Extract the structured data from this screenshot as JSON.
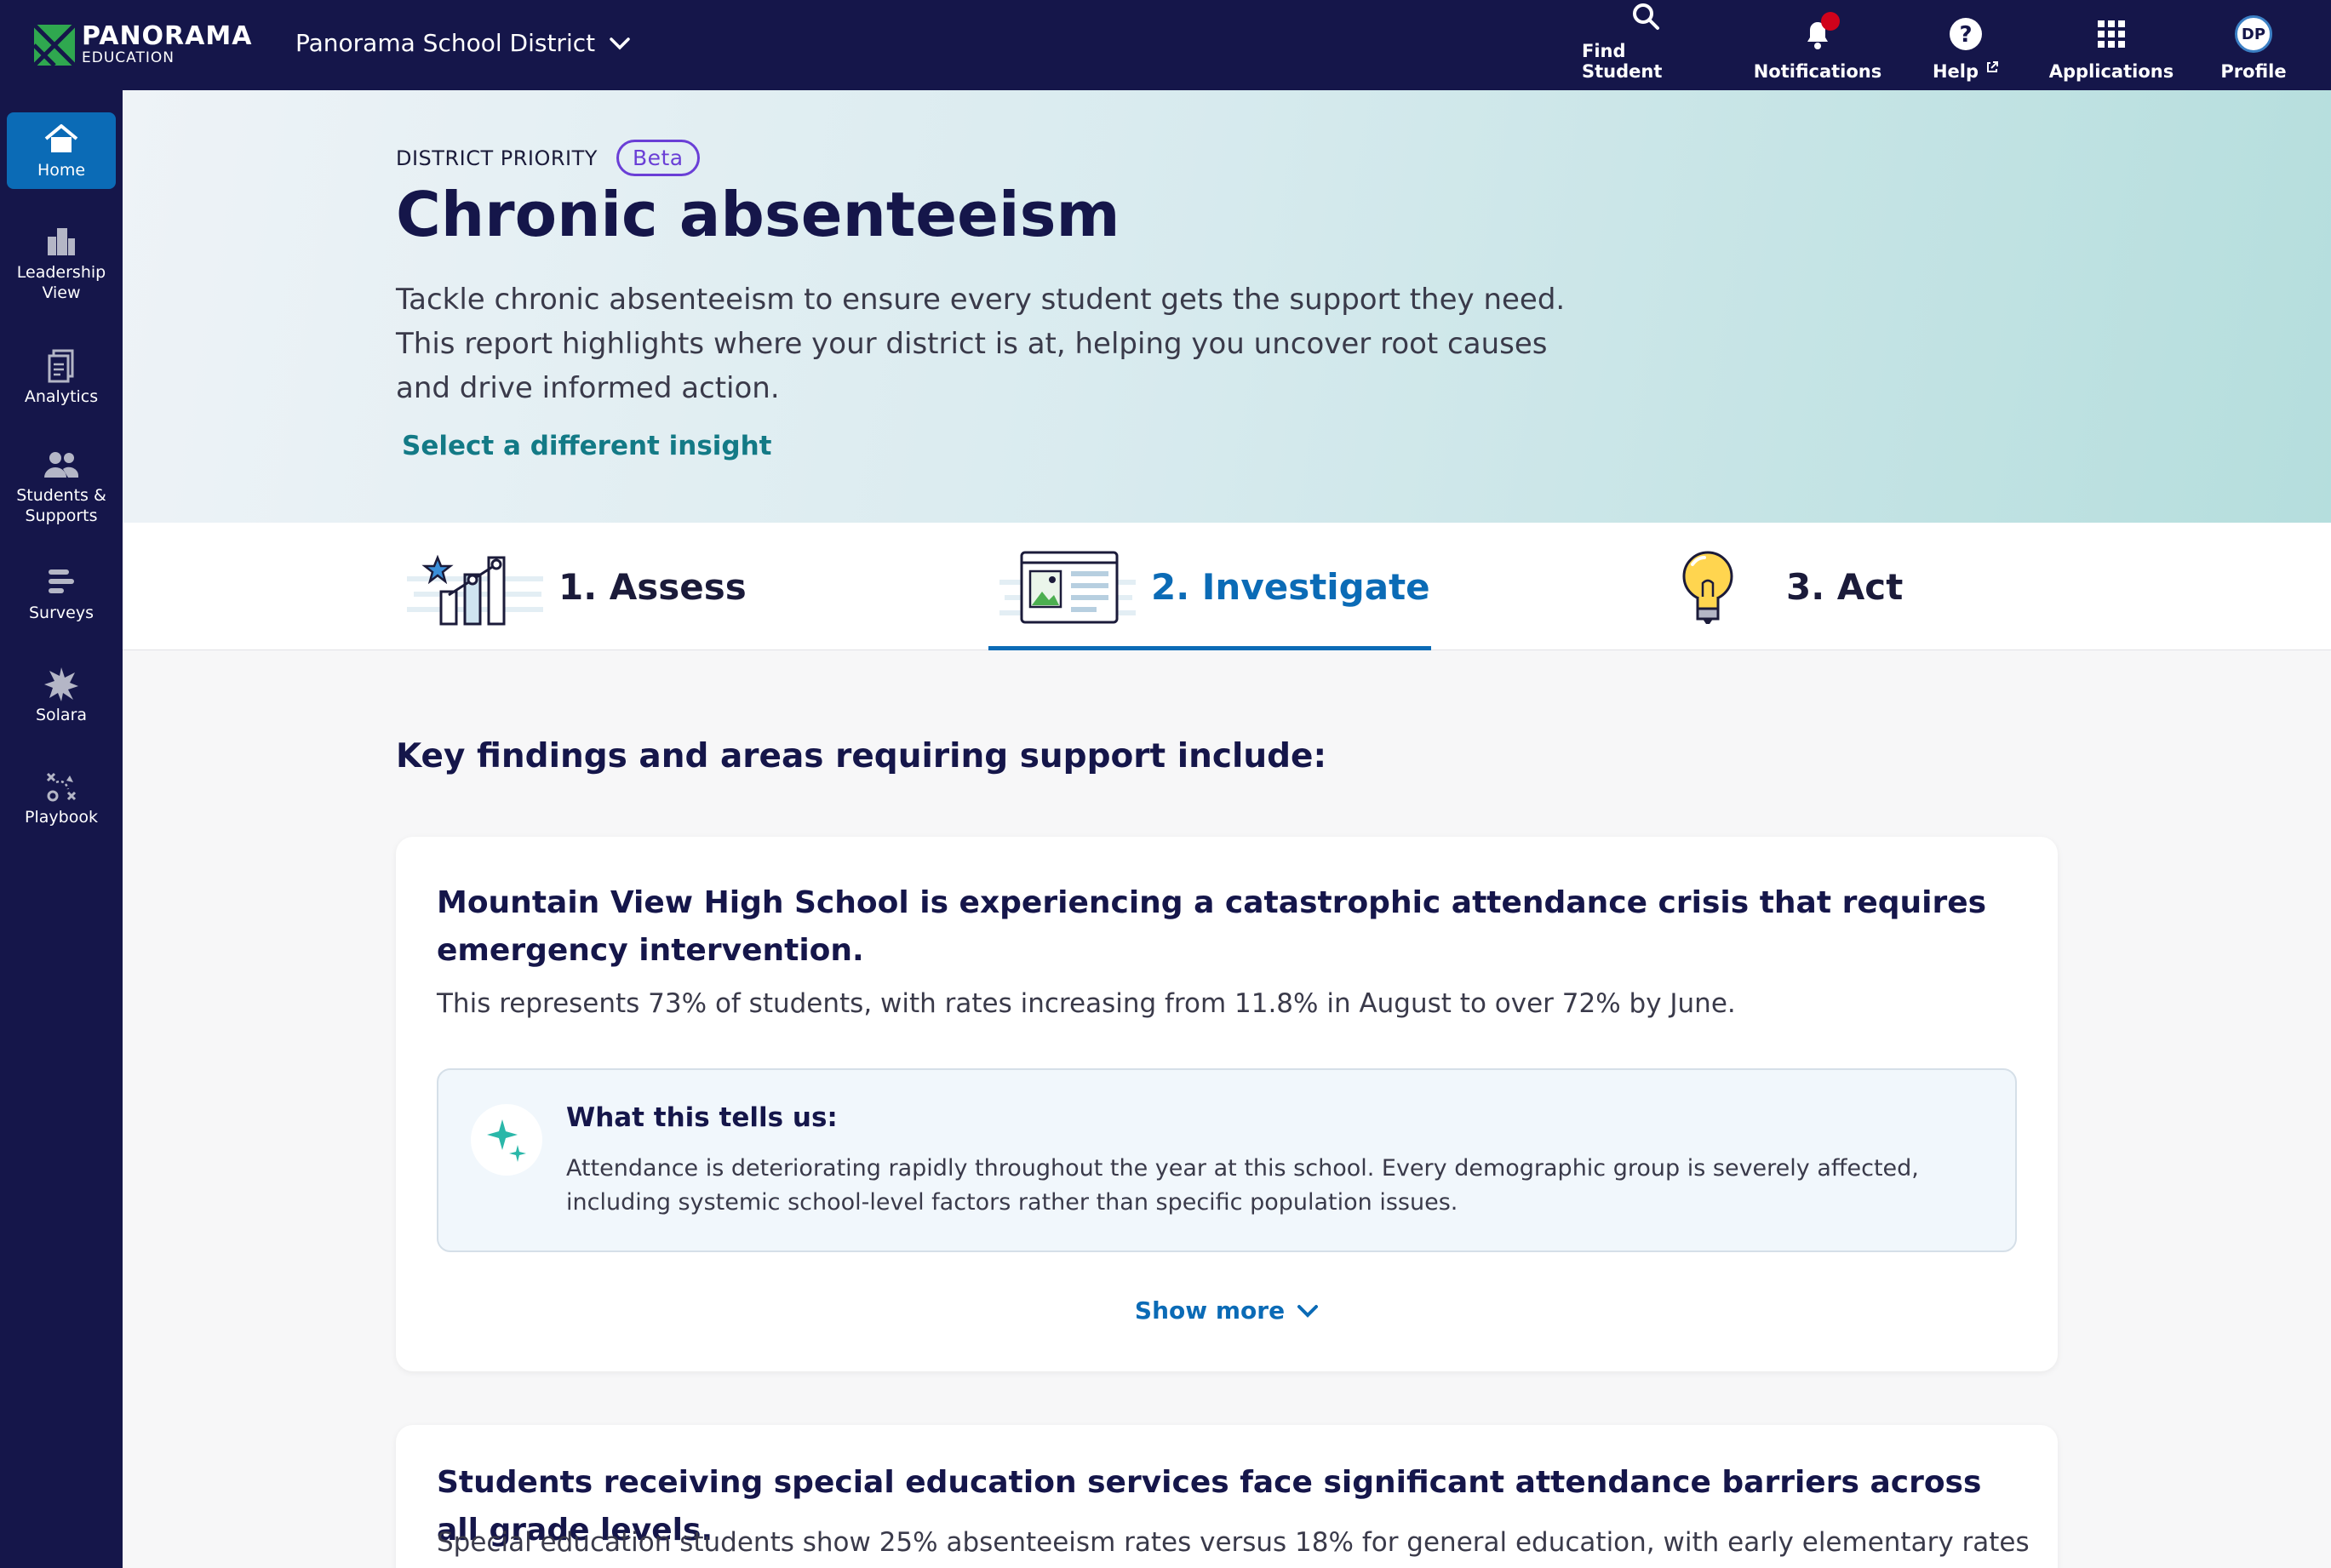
{
  "header": {
    "logo_name": "PANORAMA",
    "logo_sub": "EDUCATION",
    "district": "Panorama School District",
    "nav": [
      {
        "label": "Find Student",
        "icon": "search-icon"
      },
      {
        "label": "Notifications",
        "icon": "bell-icon"
      },
      {
        "label": "Help",
        "icon": "help-icon"
      },
      {
        "label": "Applications",
        "icon": "grid-icon"
      },
      {
        "label": "Profile",
        "icon": "avatar"
      }
    ],
    "avatar_initials": "DP"
  },
  "sidebar": {
    "items": [
      {
        "label": "Home",
        "icon": "home-icon"
      },
      {
        "label": "Leadership View",
        "icon": "building-icon"
      },
      {
        "label": "Analytics",
        "icon": "document-icon"
      },
      {
        "label": "Students & Supports",
        "icon": "people-icon"
      },
      {
        "label": "Surveys",
        "icon": "survey-icon"
      },
      {
        "label": "Solara",
        "icon": "star-burst-icon"
      },
      {
        "label": "Playbook",
        "icon": "playbook-icon"
      }
    ]
  },
  "hero": {
    "eyebrow": "DISTRICT PRIORITY",
    "badge": "Beta",
    "title": "Chronic absenteeism",
    "description": "Tackle chronic absenteeism to ensure every student gets the support they need. This report highlights where your district is at, helping you uncover root causes and drive informed action.",
    "link": "Select a different insight"
  },
  "steps": [
    {
      "label": "1. Assess"
    },
    {
      "label": "2. Investigate"
    },
    {
      "label": "3. Act"
    }
  ],
  "content": {
    "section_title": "Key findings and areas requiring support include:",
    "cards": [
      {
        "title": "Mountain View High School is experiencing a catastrophic attendance crisis that requires emergency intervention.",
        "subtitle": "This represents 73% of students, with rates increasing from 11.8% in August to over 72% by June.",
        "tells_title": "What this tells us:",
        "tells_body": "Attendance is deteriorating rapidly throughout the year at this school. Every demographic group is severely affected, including systemic school-level factors rather than specific population issues.",
        "show_more": "Show more"
      },
      {
        "title": "Students receiving special education services face significant attendance barriers across all grade levels.",
        "subtitle": "Special education students show 25% absenteeism rates versus 18% for general education, with early elementary rates"
      }
    ]
  },
  "colors": {
    "navy": "#15164a",
    "accent_blue": "#0b6bb6",
    "teal_link": "#137a86",
    "beta_purple": "#6a3fd6",
    "notification_red": "#d0021b"
  }
}
